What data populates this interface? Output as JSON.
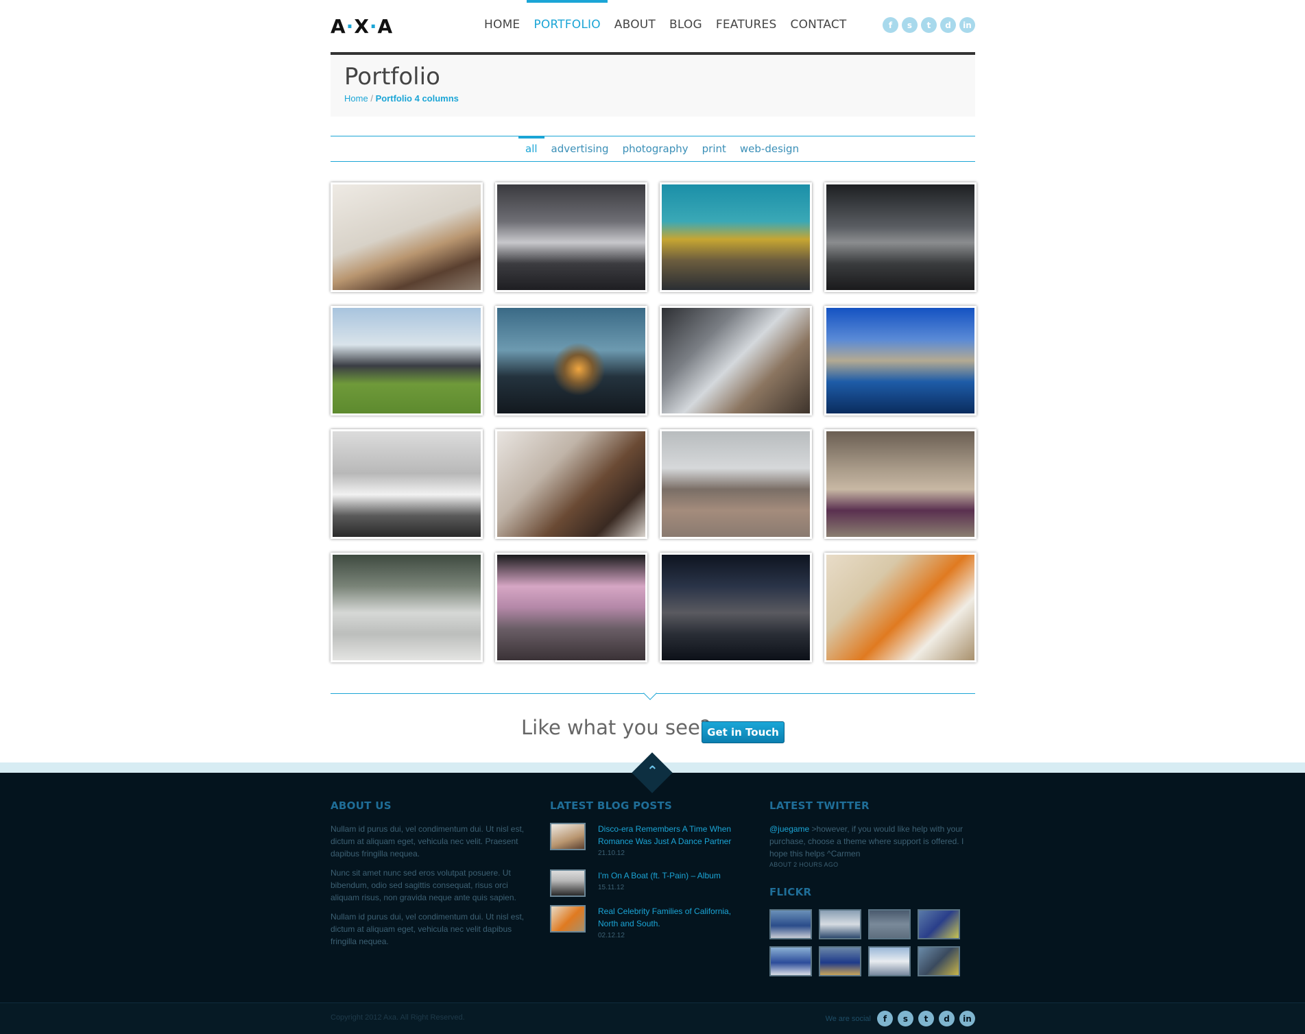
{
  "brand": {
    "logo_a": "A",
    "logo_x": "X",
    "logo_a2": "A",
    "dot": "·",
    "accent": "#1ba5d6",
    "footer_bg": "#04141e"
  },
  "nav": {
    "items": [
      "HOME",
      "PORTFOLIO",
      "ABOUT",
      "BLOG",
      "FEATURES",
      "CONTACT"
    ],
    "active": "PORTFOLIO"
  },
  "social": [
    "f",
    "s",
    "t",
    "d",
    "in"
  ],
  "page": {
    "title": "Portfolio",
    "crumb_home": "Home",
    "crumb_sep": "/",
    "crumb_current": "Portfolio 4 columns"
  },
  "filters": {
    "items": [
      "all",
      "advertising",
      "photography",
      "print",
      "web-design"
    ],
    "active": "all"
  },
  "portfolio": {
    "count": 16
  },
  "cta": {
    "text": "Like what you see?",
    "button": "Get in Touch"
  },
  "footer": {
    "about": {
      "heading": "ABOUT US",
      "paragraphs": [
        "Nullam id purus dui, vel condimentum dui. Ut nisl est, dictum at aliquam eget, vehicula nec velit. Praesent dapibus fringilla nequea.",
        "Nunc sit amet nunc sed eros volutpat posuere. Ut bibendum, odio sed sagittis consequat, risus orci aliquam risus, non gravida neque ante quis sapien.",
        "Nullam id purus dui, vel condimentum dui. Ut nisl est, dictum at aliquam eget, vehicula nec velit dapibus fringilla nequea."
      ]
    },
    "blog": {
      "heading": "LATEST BLOG POSTS",
      "posts": [
        {
          "title": "Disco-era Remembers A Time When Romance Was Just A Dance Partner",
          "date": "21.10.12"
        },
        {
          "title": "I'm On A Boat (ft. T-Pain) – Album",
          "date": "15.11.12"
        },
        {
          "title": "Real Celebrity Families of California, North and South.",
          "date": "02.12.12"
        }
      ]
    },
    "twitter": {
      "heading": "LATEST TWITTER",
      "handle": "@juegame",
      "text": " >however, if you would like help with your purchase, choose a theme where support is offered. I hope this helps ^Carmen",
      "ago": "ABOUT 2 HOURS AGO"
    },
    "flickr": {
      "heading": "FLICKR",
      "count": 8
    },
    "copyright": "Copyright 2012 Axa. All Right Reserved.",
    "social_label": "We are social"
  }
}
